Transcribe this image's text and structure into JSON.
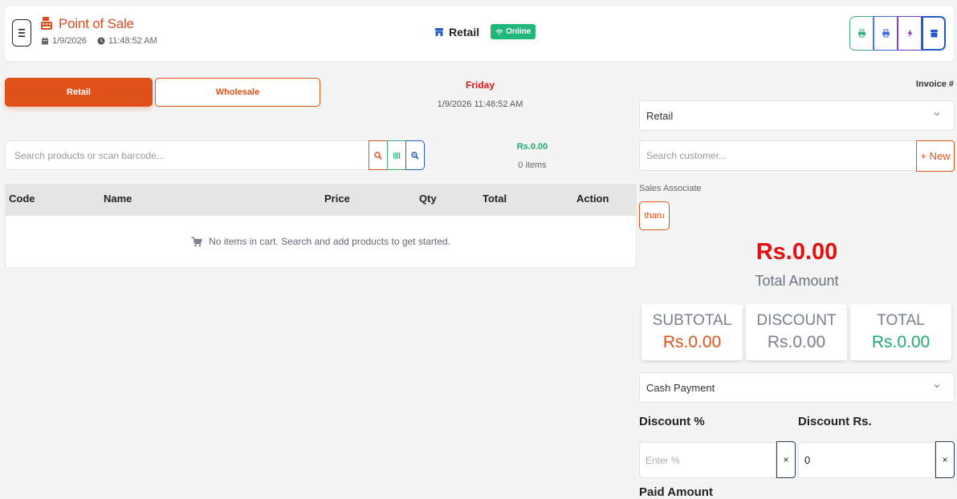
{
  "header": {
    "title": "Point of Sale",
    "date": "1/9/2026",
    "time": "11:48:52 AM",
    "mode": "Retail",
    "status": "Online",
    "tools": [
      "print-receipt-icon",
      "print-icon",
      "bolt-icon",
      "store-icon"
    ]
  },
  "tabs": {
    "retail": "Retail",
    "wholesale": "Wholesale"
  },
  "clock": {
    "day": "Friday",
    "datetime": "1/9/2026 11:48:52 AM"
  },
  "search": {
    "placeholder": "Search products or scan barcode..."
  },
  "cart_summary": {
    "total": "Rs.0.00",
    "items": "0 items"
  },
  "table": {
    "headers": [
      "Code",
      "Name",
      "Price",
      "Qty",
      "Total",
      "Action"
    ],
    "empty_message": "No items in cart. Search and add products to get started."
  },
  "right_panel": {
    "invoice_label": "Invoice #",
    "sale_type": "Retail",
    "customer_placeholder": "Search customer...",
    "new_button": "+ New",
    "sales_associate_label": "Sales Associate",
    "sales_associate": "tharu",
    "total_amount": "Rs.0.00",
    "total_amount_label": "Total Amount",
    "summary": [
      {
        "label": "SUBTOTAL",
        "value": "Rs.0.00",
        "color": "#d9541c"
      },
      {
        "label": "DISCOUNT",
        "value": "Rs.0.00",
        "color": "#7a7f8a"
      },
      {
        "label": "TOTAL",
        "value": "Rs.0.00",
        "color": "#21a86a"
      }
    ],
    "payment_method": "Cash Payment",
    "discount_percent_label": "Discount %",
    "discount_percent_placeholder": "Enter %",
    "discount_rs_label": "Discount Rs.",
    "discount_rs_value": "0",
    "clear_label": "×",
    "paid_amount_label": "Paid Amount"
  },
  "colors": {
    "accent": "#e0511a",
    "success": "#21b67a",
    "danger": "#e31010",
    "primary": "#2459c7"
  }
}
